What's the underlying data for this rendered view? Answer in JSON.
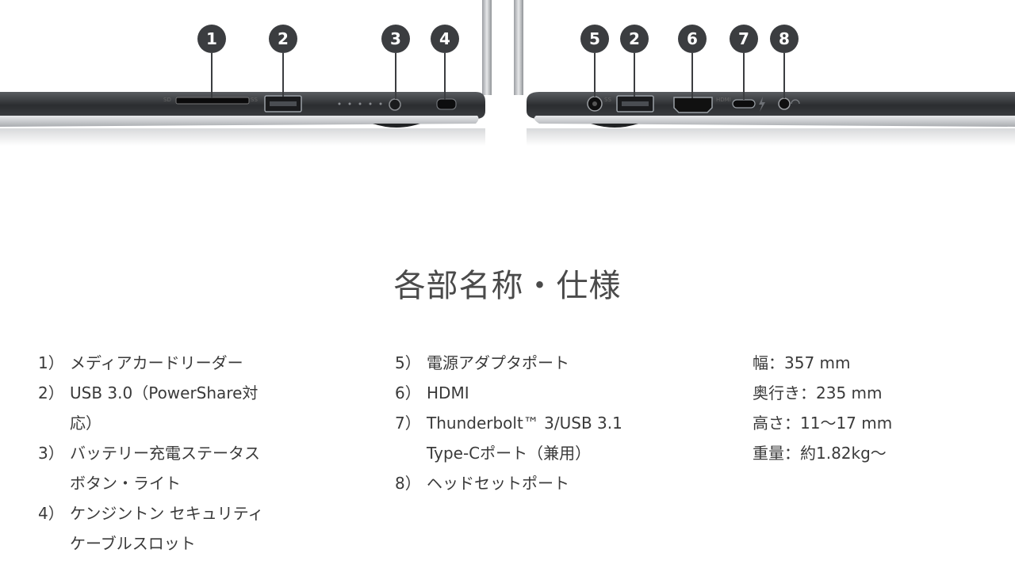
{
  "figure": {
    "callouts_left": [
      "1",
      "2",
      "3",
      "4"
    ],
    "callouts_right": [
      "5",
      "2",
      "6",
      "7",
      "8"
    ],
    "port_labels": {
      "sd": "SD",
      "usb_ss": "SS",
      "hdmi": "HDMI"
    },
    "colors": {
      "callout_fill": "#3b3d40",
      "chassis": "#2e3033",
      "silver": "#c9ccd0"
    }
  },
  "title": "各部名称・仕様",
  "ports_left": [
    {
      "num": "1）",
      "lines": [
        "メディアカードリーダー"
      ]
    },
    {
      "num": "2）",
      "lines": [
        "USB 3.0（PowerShare対",
        "応）"
      ]
    },
    {
      "num": "3）",
      "lines": [
        "バッテリー充電ステータス",
        "ボタン・ライト"
      ]
    },
    {
      "num": "4）",
      "lines": [
        "ケンジントン セキュリティ",
        "ケーブルスロット"
      ]
    }
  ],
  "ports_right": [
    {
      "num": "5）",
      "lines": [
        "電源アダプタポート"
      ]
    },
    {
      "num": "6）",
      "lines": [
        "HDMI"
      ]
    },
    {
      "num": "7）",
      "lines": [
        "Thunderbolt™ 3/USB 3.1",
        "Type-Cポート（兼用）"
      ]
    },
    {
      "num": "8）",
      "lines": [
        "ヘッドセットポート"
      ]
    }
  ],
  "specs": [
    "幅：357 mm",
    "奥行き：235 mm",
    "高さ：11〜17 mm",
    "重量：約1.82kg〜"
  ]
}
